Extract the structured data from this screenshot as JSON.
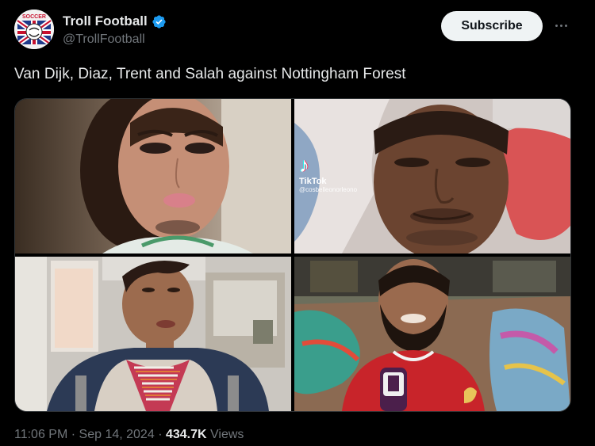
{
  "account": {
    "display_name": "Troll Football",
    "handle": "@TrollFootball",
    "avatar_text": "SOCCER"
  },
  "subscribe_label": "Subscribe",
  "tweet": {
    "text": "Van Dijk, Diaz, Trent and Salah against Nottingham Forest"
  },
  "media": {
    "tiktok_logo": "♪",
    "tiktok_brand": "TikTok",
    "tiktok_user": "@cosbelleonorleono"
  },
  "footer": {
    "time": "11:06 PM",
    "separator": "·",
    "date": "Sep 14, 2024",
    "views_count": "434.7K",
    "views_label": "Views"
  },
  "colors": {
    "background": "#000000",
    "text_primary": "#e7e9ea",
    "text_secondary": "#71767b",
    "verified_blue": "#1d9bf0",
    "button_bg": "#eff3f4"
  }
}
